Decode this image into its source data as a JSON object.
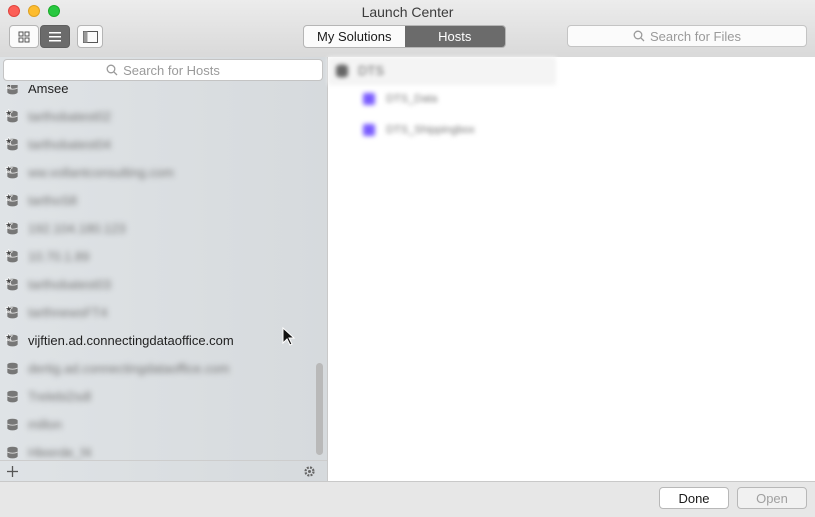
{
  "window": {
    "title": "Launch Center"
  },
  "toolbar": {
    "segments": [
      {
        "label": "My Solutions",
        "active": false
      },
      {
        "label": "Hosts",
        "active": true
      }
    ],
    "search_files_placeholder": "Search for Files"
  },
  "sidebar": {
    "search_placeholder": "Search for Hosts",
    "hosts": [
      {
        "label": "Amsee",
        "icon": "database-star-icon",
        "blurred": false
      },
      {
        "label": "tarthobatest02",
        "icon": "database-star-icon",
        "blurred": true
      },
      {
        "label": "tarthobatest04",
        "icon": "database-star-icon",
        "blurred": true
      },
      {
        "label": "ww.vollantconsulting.com",
        "icon": "database-star-icon",
        "blurred": true
      },
      {
        "label": "tarthoS8",
        "icon": "database-star-icon",
        "blurred": true
      },
      {
        "label": "192.104.180.123",
        "icon": "database-star-icon",
        "blurred": true
      },
      {
        "label": "10.70.1.89",
        "icon": "database-star-icon",
        "blurred": true
      },
      {
        "label": "tarthobatest03",
        "icon": "database-star-icon",
        "blurred": true
      },
      {
        "label": "tarthnewsFT4",
        "icon": "database-star-icon",
        "blurred": true
      },
      {
        "label": "vijftien.ad.connectingdataoffice.com",
        "icon": "database-star-icon",
        "blurred": false
      },
      {
        "label": "dertig.ad.connectingdataoffice.com",
        "icon": "database-icon",
        "blurred": true
      },
      {
        "label": "Trelebi2sdl",
        "icon": "database-icon",
        "blurred": true
      },
      {
        "label": "millon",
        "icon": "database-icon",
        "blurred": true
      },
      {
        "label": "Hleerde_f4",
        "icon": "database-icon",
        "blurred": true
      }
    ]
  },
  "main": {
    "host_name": "DTS",
    "files": [
      "DTS_Data",
      "DTS_Shippingbox"
    ]
  },
  "footer": {
    "done_label": "Done",
    "open_label": "Open"
  }
}
